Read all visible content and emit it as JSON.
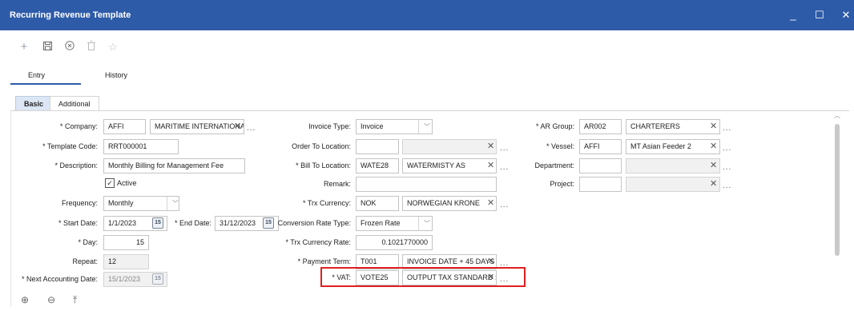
{
  "window": {
    "title": "Recurring Revenue Template",
    "minimize": "_",
    "maximize": "☐",
    "close": "✕"
  },
  "toolbar": [
    "plus-icon",
    "save-icon",
    "cancel-icon",
    "delete-icon",
    "star-icon"
  ],
  "tabs": [
    {
      "label": "Entry",
      "active": true
    },
    {
      "label": "History",
      "active": false
    }
  ],
  "subtabs": [
    {
      "label": "Basic",
      "active": true
    },
    {
      "label": "Additional",
      "active": false
    }
  ],
  "form": {
    "company": {
      "label": "* Company:",
      "code": "AFFI",
      "name": "MARITIME INTERNATIONA"
    },
    "template_code": {
      "label": "* Template Code:",
      "value": "RRT000001"
    },
    "description": {
      "label": "* Description:",
      "value": "Monthly Billing for Management Fee"
    },
    "active": {
      "label": "Active",
      "checked": true
    },
    "frequency": {
      "label": "Frequency:",
      "value": "Monthly"
    },
    "start_date": {
      "label": "* Start Date:",
      "value": "1/1/2023"
    },
    "end_date": {
      "label": "* End Date:",
      "value": "31/12/2023"
    },
    "day": {
      "label": "* Day:",
      "value": "15"
    },
    "repeat": {
      "label": "Repeat:",
      "value": "12"
    },
    "next_accounting_date": {
      "label": "* Next Accounting Date:",
      "value": "15/1/2023"
    },
    "invoice_type": {
      "label": "Invoice Type:",
      "value": "Invoice"
    },
    "order_to_location": {
      "label": "Order To Location:",
      "code": "",
      "name": ""
    },
    "bill_to_location": {
      "label": "* Bill To Location:",
      "code": "WATE28",
      "name": "WATERMISTY AS"
    },
    "remark": {
      "label": "Remark:",
      "value": ""
    },
    "trx_currency": {
      "label": "* Trx Currency:",
      "code": "NOK",
      "name": "NORWEGIAN KRONE"
    },
    "conversion_rate_type": {
      "label": "Conversion Rate Type:",
      "value": "Frozen Rate"
    },
    "trx_currency_rate": {
      "label": "* Trx Currency Rate:",
      "value": "0.1021770000"
    },
    "payment_term": {
      "label": "* Payment Term:",
      "code": "T001",
      "name": "INVOICE DATE + 45 DAYS"
    },
    "vat": {
      "label": "* VAT:",
      "code": "VOTE25",
      "name": "OUTPUT TAX STANDARD :"
    },
    "ar_group": {
      "label": "* AR Group:",
      "code": "AR002",
      "name": "CHARTERERS"
    },
    "vessel": {
      "label": "* Vessel:",
      "code": "AFFI",
      "name": "MT Asian Feeder 2"
    },
    "department": {
      "label": "Department:",
      "code": "",
      "name": ""
    },
    "project": {
      "label": "Project:",
      "code": "",
      "name": ""
    }
  },
  "calendar_icon_text": "15",
  "dots": "...",
  "clear": "✕",
  "chevron": "﹀",
  "highlight_color": "#e02020",
  "accent_color": "#2e5ba8"
}
